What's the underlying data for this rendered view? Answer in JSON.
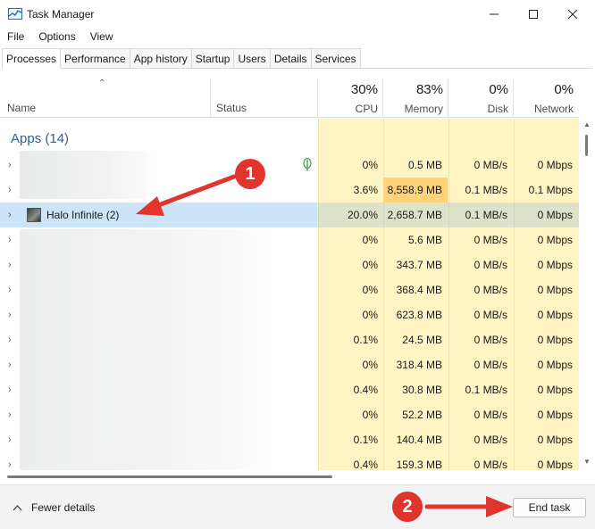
{
  "window": {
    "title": "Task Manager",
    "controls": {
      "minimize": "—",
      "maximize": "☐",
      "close": "✕"
    }
  },
  "menu": [
    "File",
    "Options",
    "View"
  ],
  "tabs": [
    {
      "label": "Processes",
      "active": true
    },
    {
      "label": "Performance",
      "active": false
    },
    {
      "label": "App history",
      "active": false
    },
    {
      "label": "Startup",
      "active": false
    },
    {
      "label": "Users",
      "active": false
    },
    {
      "label": "Details",
      "active": false
    },
    {
      "label": "Services",
      "active": false
    }
  ],
  "columns": {
    "name": "Name",
    "status": "Status",
    "cpu": {
      "pct": "30%",
      "label": "CPU"
    },
    "memory": {
      "pct": "83%",
      "label": "Memory"
    },
    "disk": {
      "pct": "0%",
      "label": "Disk"
    },
    "network": {
      "pct": "0%",
      "label": "Network"
    }
  },
  "section": {
    "title": "Apps (14)"
  },
  "rows": [
    {
      "name": "",
      "cpu": "0%",
      "memory": "0.5 MB",
      "disk": "0 MB/s",
      "network": "0 Mbps"
    },
    {
      "name": "",
      "cpu": "3.6%",
      "memory": "8,558.9 MB",
      "disk": "0.1 MB/s",
      "network": "0.1 Mbps"
    },
    {
      "name": "Halo Infinite (2)",
      "cpu": "20.0%",
      "memory": "2,658.7 MB",
      "disk": "0.1 MB/s",
      "network": "0 Mbps"
    },
    {
      "name": "",
      "cpu": "0%",
      "memory": "5.6 MB",
      "disk": "0 MB/s",
      "network": "0 Mbps"
    },
    {
      "name": "",
      "cpu": "0%",
      "memory": "343.7 MB",
      "disk": "0 MB/s",
      "network": "0 Mbps"
    },
    {
      "name": "",
      "cpu": "0%",
      "memory": "368.4 MB",
      "disk": "0 MB/s",
      "network": "0 Mbps"
    },
    {
      "name": "",
      "cpu": "0%",
      "memory": "623.8 MB",
      "disk": "0 MB/s",
      "network": "0 Mbps"
    },
    {
      "name": "",
      "cpu": "0.1%",
      "memory": "24.5 MB",
      "disk": "0 MB/s",
      "network": "0 Mbps"
    },
    {
      "name": "",
      "cpu": "0%",
      "memory": "318.4 MB",
      "disk": "0 MB/s",
      "network": "0 Mbps"
    },
    {
      "name": "",
      "cpu": "0.4%",
      "memory": "30.8 MB",
      "disk": "0.1 MB/s",
      "network": "0 Mbps"
    },
    {
      "name": "",
      "cpu": "0%",
      "memory": "52.2 MB",
      "disk": "0 MB/s",
      "network": "0 Mbps"
    },
    {
      "name": "",
      "cpu": "0.1%",
      "memory": "140.4 MB",
      "disk": "0 MB/s",
      "network": "0 Mbps"
    },
    {
      "name": "",
      "cpu": "0.4%",
      "memory": "159.3 MB",
      "disk": "0 MB/s",
      "network": "0 Mbps"
    }
  ],
  "footer": {
    "fewer_details": "Fewer details",
    "end_task": "End task"
  },
  "annotations": {
    "marker1": "1",
    "marker2": "2",
    "color": "#e0342c"
  },
  "colors": {
    "heat_light": "#fff4c4",
    "heat_high": "#ffd37a",
    "selection": "#cce4f7",
    "section": "#2a5ea8"
  }
}
